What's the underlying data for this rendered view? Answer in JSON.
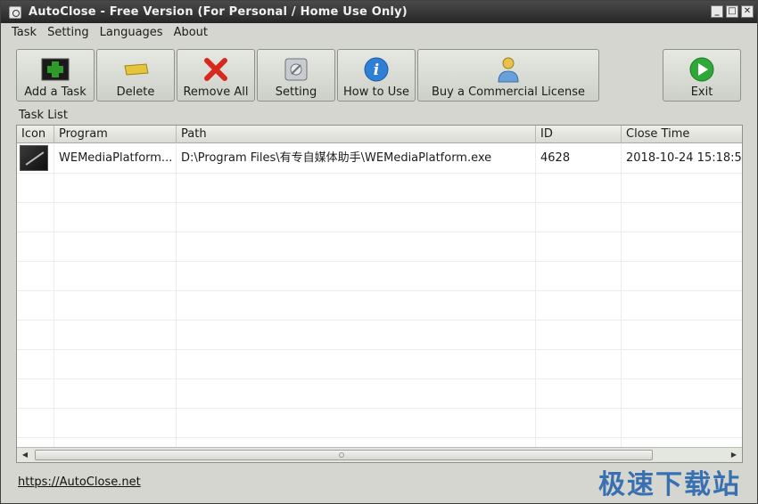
{
  "window": {
    "title": "AutoClose - Free Version (For Personal / Home Use Only)",
    "controls": [
      "_",
      "□",
      "✕"
    ]
  },
  "menu": [
    "Task",
    "Setting",
    "Languages",
    "About"
  ],
  "toolbar": {
    "add_task": "Add a Task",
    "delete": "Delete",
    "remove_all": "Remove All",
    "setting": "Setting",
    "how_to_use": "How to Use",
    "buy_license": "Buy a Commercial License",
    "exit": "Exit"
  },
  "task_list": {
    "label": "Task List",
    "columns": [
      "Icon",
      "Program",
      "Path",
      "ID",
      "Close Time"
    ],
    "rows": [
      {
        "icon": "program-icon",
        "program": "WEMediaPlatform...",
        "path": "D:\\Program Files\\有专自媒体助手\\WEMediaPlatform.exe",
        "id": "4628",
        "close_time": "2018-10-24 15:18:5"
      }
    ]
  },
  "footer": {
    "link": "https://AutoClose.net"
  },
  "watermark": "极速下载站",
  "colors": {
    "add_green": "#2e9a2a",
    "delete_yellow": "#e6c53a",
    "remove_red": "#d9281e",
    "info_blue": "#2f7fd6",
    "exit_green": "#2fa83a",
    "watermark_blue": "#1f5fae"
  }
}
